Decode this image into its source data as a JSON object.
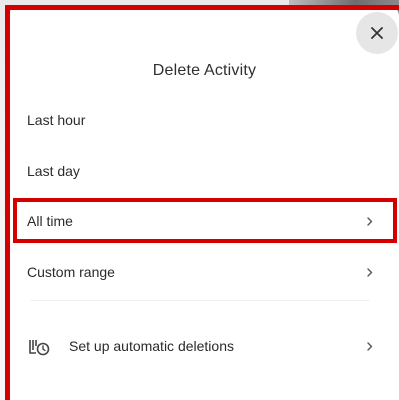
{
  "dialog": {
    "title": "Delete Activity",
    "close_icon": "close-icon",
    "options": [
      {
        "label": "Last hour",
        "has_chevron": false
      },
      {
        "label": "Last day",
        "has_chevron": false
      },
      {
        "label": "All time",
        "has_chevron": true
      },
      {
        "label": "Custom range",
        "has_chevron": true
      }
    ],
    "auto_delete": {
      "label": "Set up automatic deletions",
      "icon": "auto-delete-schedule-icon"
    }
  },
  "colors": {
    "highlight": "#d40000",
    "text": "#2b2b2b",
    "title": "#303030",
    "close_bg": "#e6e6e6"
  }
}
